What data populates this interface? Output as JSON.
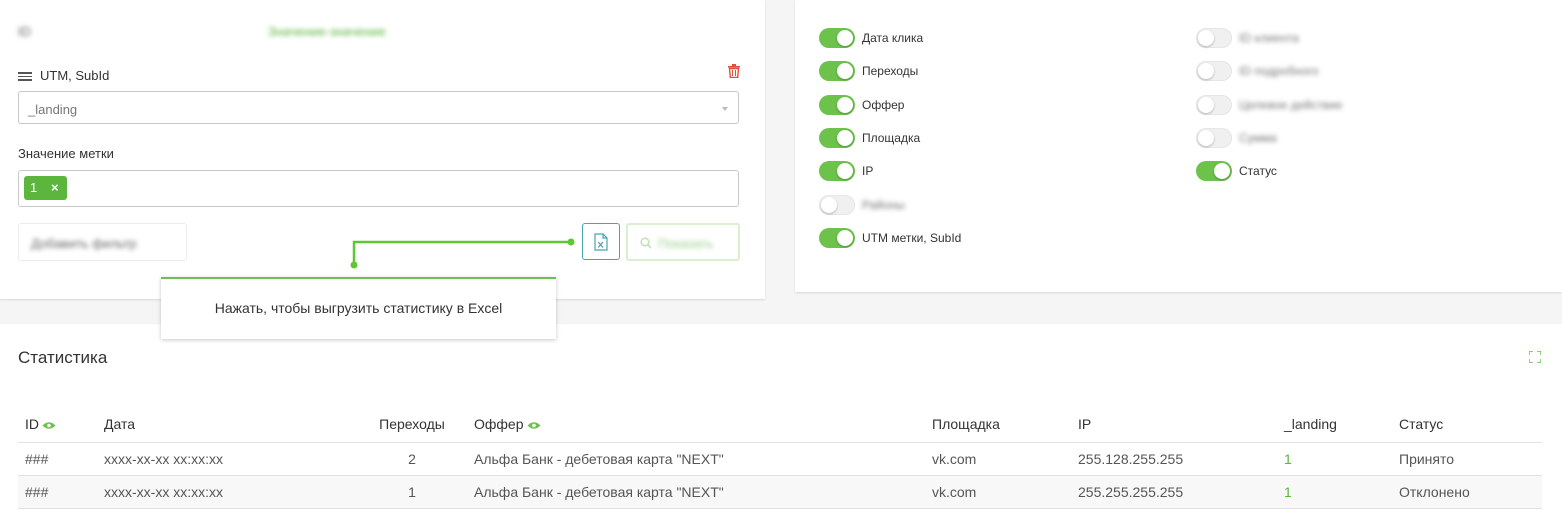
{
  "filters": {
    "blurred_row": [
      "ID",
      "Значение-значение"
    ],
    "utm_label": "UTM, SubId",
    "utm_select_value": "_landing",
    "tag_value_label": "Значение метки",
    "tag_chip_value": "1",
    "tag_chip_remove": "×",
    "add_filter_label": "Добавить фильтр",
    "show_label": "Показать",
    "tooltip_text": "Нажать, чтобы выгрузить статистику в Excel"
  },
  "columns_toggles": {
    "left": [
      {
        "label": "Дата клика",
        "on": true
      },
      {
        "label": "Переходы",
        "on": true
      },
      {
        "label": "Оффер",
        "on": true
      },
      {
        "label": "Площадка",
        "on": true
      },
      {
        "label": "IP",
        "on": true
      },
      {
        "label": "Районы",
        "on": false
      },
      {
        "label": "UTM метки, SubId",
        "on": true
      }
    ],
    "right": [
      {
        "label": "ID клиента",
        "on": false
      },
      {
        "label": "ID подробного",
        "on": false
      },
      {
        "label": "Целевое действие",
        "on": false
      },
      {
        "label": "Сумма",
        "on": false
      },
      {
        "label": "Статус",
        "on": true
      }
    ]
  },
  "stats": {
    "title": "Статистика",
    "headers": [
      "ID",
      "Дата",
      "Переходы",
      "Оффер",
      "Площадка",
      "IP",
      "_landing",
      "Статус"
    ],
    "rows": [
      [
        "###",
        "xxxx-xx-xx xx:xx:xx",
        "2",
        "Альфа Банк - дебетовая карта \"NEXT\"",
        "vk.com",
        "255.128.255.255",
        "1",
        "Принято"
      ],
      [
        "###",
        "xxxx-xx-xx xx:xx:xx",
        "1",
        "Альфа Банк - дебетовая карта \"NEXT\"",
        "vk.com",
        "255.255.255.255",
        "1",
        "Отклонено"
      ]
    ]
  },
  "colors": {
    "accent": "#6cc24a",
    "excel_border": "#4aa3b5",
    "trash": "#e74c3c"
  },
  "icons": [
    "drag-handle-icon",
    "trash-icon",
    "chevron-down-icon",
    "close-icon",
    "excel-file-icon",
    "search-icon",
    "eye-icon",
    "expand-icon"
  ]
}
